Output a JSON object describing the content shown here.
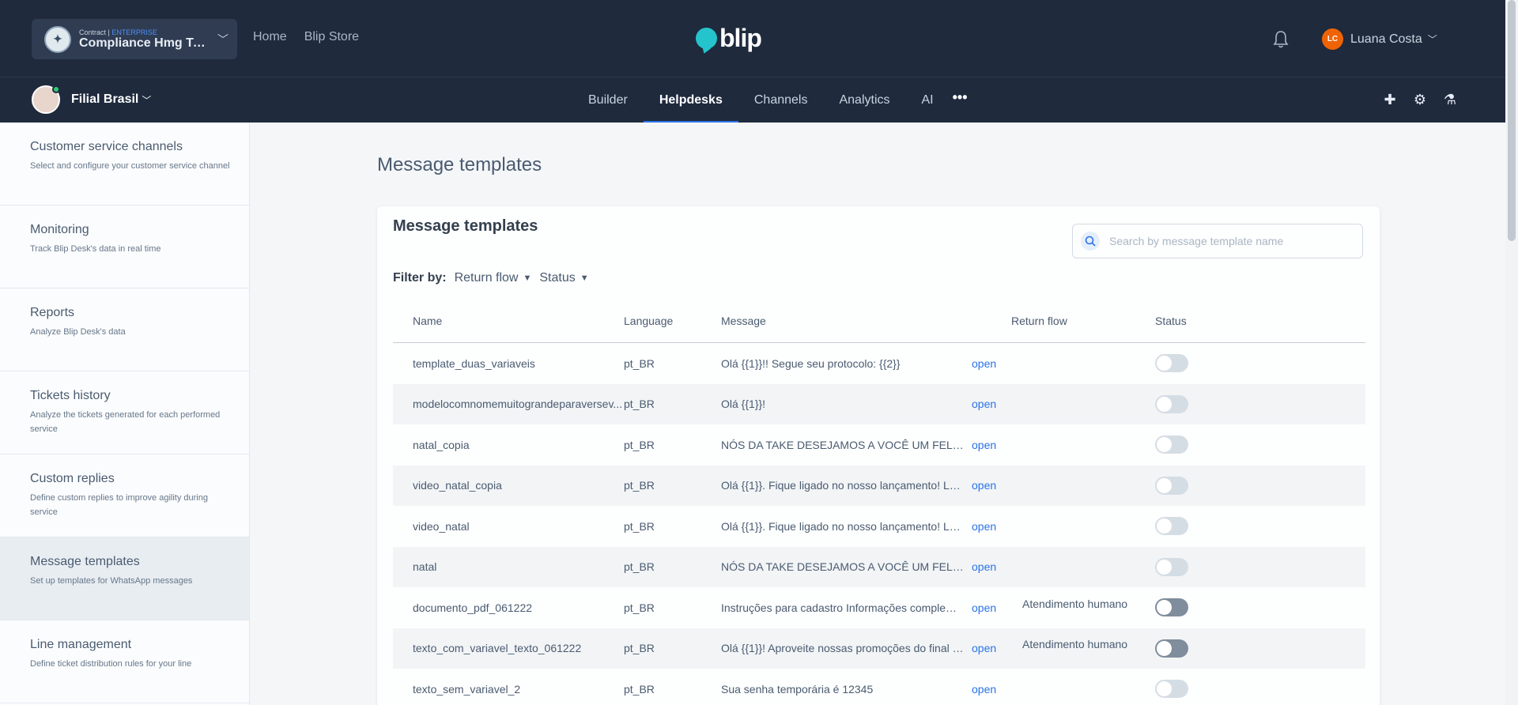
{
  "header": {
    "contract_small": "Contract | ",
    "contract_tier": "ENTERPRISE",
    "contract_name": "Compliance Hmg Ta...",
    "nav": [
      "Home",
      "Blip Store"
    ],
    "brand": "blip",
    "user_initials": "LC",
    "user_name": "Luana Costa"
  },
  "subnav": {
    "bot_name": "Filial Brasil",
    "items": [
      "Builder",
      "Helpdesks",
      "Channels",
      "Analytics",
      "AI"
    ],
    "active": "Helpdesks",
    "more": "•••"
  },
  "sidebar": {
    "items": [
      {
        "title": "Customer service channels",
        "desc": "Select and configure your customer service channel"
      },
      {
        "title": "Monitoring",
        "desc": "Track Blip Desk's data in real time"
      },
      {
        "title": "Reports",
        "desc": "Analyze Blip Desk's data"
      },
      {
        "title": "Tickets history",
        "desc": "Analyze the tickets generated for each performed service"
      },
      {
        "title": "Custom replies",
        "desc": "Define custom replies to improve agility during service"
      },
      {
        "title": "Message templates",
        "desc": "Set up templates for WhatsApp messages"
      },
      {
        "title": "Line management",
        "desc": "Define ticket distribution rules for your line"
      }
    ],
    "active_index": 5
  },
  "page": {
    "title": "Message templates",
    "card_title": "Message templates",
    "search_placeholder": "Search by message template name",
    "filter_label": "Filter by:",
    "filter_return_flow": "Return flow",
    "filter_status": "Status"
  },
  "table": {
    "headers": {
      "name": "Name",
      "language": "Language",
      "message": "Message",
      "return_flow": "Return flow",
      "status": "Status"
    },
    "open_label": "open",
    "rows": [
      {
        "name": "template_duas_variaveis",
        "language": "pt_BR",
        "message": "Olá {{1}}!! Segue seu protocolo: {{2}}",
        "return_flow": "",
        "status_on": false
      },
      {
        "name": "modelocomnomemuitograndeparaversev...",
        "language": "pt_BR",
        "message": "Olá {{1}}!",
        "return_flow": "",
        "status_on": false
      },
      {
        "name": "natal_copia",
        "language": "pt_BR",
        "message": "NÓS DA TAKE DESEJAMOS A VOCÊ UM FELIZ ...",
        "return_flow": "",
        "status_on": false
      },
      {
        "name": "video_natal_copia",
        "language": "pt_BR",
        "message": "Olá {{1}}. Fique ligado no nosso lançamento! Lan...",
        "return_flow": "",
        "status_on": false
      },
      {
        "name": "video_natal",
        "language": "pt_BR",
        "message": "Olá {{1}}. Fique ligado no nosso lançamento! Lan...",
        "return_flow": "",
        "status_on": false
      },
      {
        "name": "natal",
        "language": "pt_BR",
        "message": "NÓS DA TAKE DESEJAMOS A VOCÊ UM FELIZ ...",
        "return_flow": "",
        "status_on": false
      },
      {
        "name": "documento_pdf_061222",
        "language": "pt_BR",
        "message": "Instruções para cadastro Informações compleme...",
        "return_flow": "Atendimento humano",
        "status_on": true
      },
      {
        "name": "texto_com_variavel_texto_061222",
        "language": "pt_BR",
        "message": "Olá {{1}}! Aproveite nossas promoções do final d...",
        "return_flow": "Atendimento humano",
        "status_on": true
      },
      {
        "name": "texto_sem_variavel_2",
        "language": "pt_BR",
        "message": "Sua senha temporária é 12345",
        "return_flow": "",
        "status_on": false
      }
    ]
  },
  "colors": {
    "topbar": "#1f2a3d",
    "accent": "#2a73e8",
    "brand_bubble": "#25c4cc",
    "avatar": "#f06305"
  }
}
